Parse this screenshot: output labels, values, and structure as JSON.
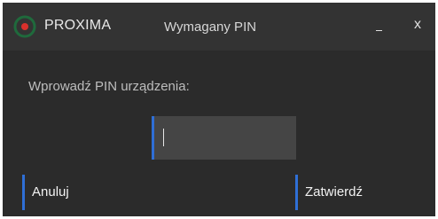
{
  "titlebar": {
    "app_name": "PROXIMA",
    "dialog_title": "Wymagany PIN",
    "minimize_label": "_",
    "close_label": "x"
  },
  "form": {
    "pin_label": "Wprowadź PIN urządzenia:",
    "pin_value": ""
  },
  "actions": {
    "cancel_label": "Anuluj",
    "confirm_label": "Zatwierdź"
  },
  "colors": {
    "window_bg": "#2b2b2b",
    "titlebar_bg": "#333333",
    "input_bg": "#454545",
    "accent_blue": "#2f6fd6",
    "logo_red": "#d8302c",
    "logo_green": "#1f6a3c"
  },
  "icons": {
    "logo": "proxima-logo-icon"
  }
}
